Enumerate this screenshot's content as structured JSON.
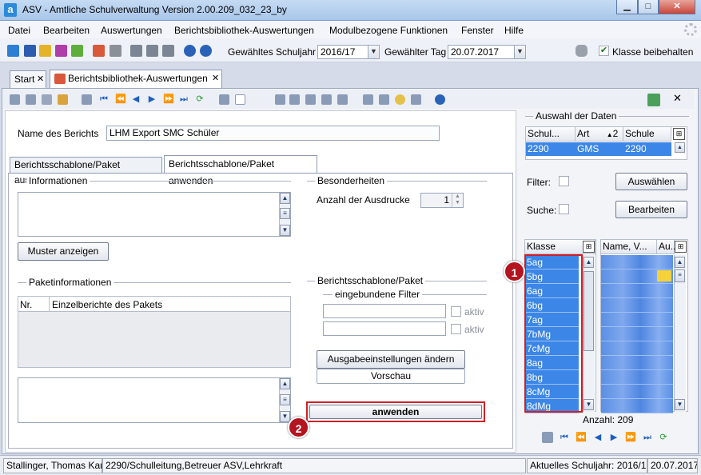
{
  "window": {
    "title": "ASV - Amtliche Schulverwaltung Version 2.00.209_032_23_by"
  },
  "menu": [
    "Datei",
    "Bearbeiten",
    "Auswertungen",
    "Berichtsbibliothek-Auswertungen",
    "Modulbezogene Funktionen",
    "Fenster",
    "Hilfe"
  ],
  "toolbar": {
    "schuljahr_label": "Gewähltes Schuljahr",
    "schuljahr_value": "2016/17",
    "tag_label": "Gewählter Tag",
    "tag_value": "20.07.2017",
    "klasse_beibehalten_label": "Klasse beibehalten",
    "klasse_beibehalten_checked": true
  },
  "tabs": [
    {
      "label": "Start",
      "close": "✕"
    },
    {
      "label": "Berichtsbibliothek-Auswertungen",
      "close": "✕"
    }
  ],
  "bericht": {
    "name_label": "Name des Berichts",
    "name_value": "LHM Export SMC Schüler"
  },
  "subtabs": [
    "Berichtsschablone/Paket auswählen",
    "Berichtsschablone/Paket anwenden"
  ],
  "left": {
    "informationen_title": "Informationen",
    "muster_button": "Muster anzeigen",
    "paketinfo_title": "Paketinformationen",
    "paket_columns": [
      "Nr.",
      "Einzelberichte des Pakets"
    ]
  },
  "besonderheiten": {
    "title": "Besonderheiten",
    "anzahl_label": "Anzahl der Ausdrucke",
    "anzahl_value": "1"
  },
  "schablone": {
    "title": "Berichtsschablone/Paket",
    "filter_title": "eingebundene Filter",
    "aktiv1": "aktiv",
    "aktiv2": "aktiv",
    "ausgabe_button": "Ausgabeeinstellungen ändern",
    "vorschau_button": "Vorschau",
    "anwenden_button": "anwenden"
  },
  "auswahl": {
    "title": "Auswahl der Daten",
    "columns": [
      "Schul...",
      "1",
      "Art",
      "2",
      "Schule"
    ],
    "row": [
      "2290",
      "GMS",
      "2290"
    ],
    "filter_label": "Filter:",
    "suche_label": "Suche:",
    "auswaehlen_button": "Auswählen",
    "bearbeiten_button": "Bearbeiten"
  },
  "klassen": {
    "header": "Klasse",
    "items": [
      "5ag",
      "5bg",
      "6ag",
      "6bg",
      "7ag",
      "7bMg",
      "7cMg",
      "8ag",
      "8bg",
      "8cMg",
      "8dMg"
    ],
    "name_header": "Name, V...",
    "au_header": "Au...",
    "anzahl": "Anzahl: 209"
  },
  "badges": [
    "1",
    "2"
  ],
  "status": {
    "user": "Stallinger, Thomas Karl",
    "role": "2290/Schulleitung,Betreuer ASV,Lehrkraft",
    "schuljahr": "Aktuelles Schuljahr: 2016/17",
    "datum": "20.07.2017"
  },
  "colors": {
    "selection": "#3b86e6",
    "highlight": "#d11f26",
    "badge": "#b3141f"
  }
}
